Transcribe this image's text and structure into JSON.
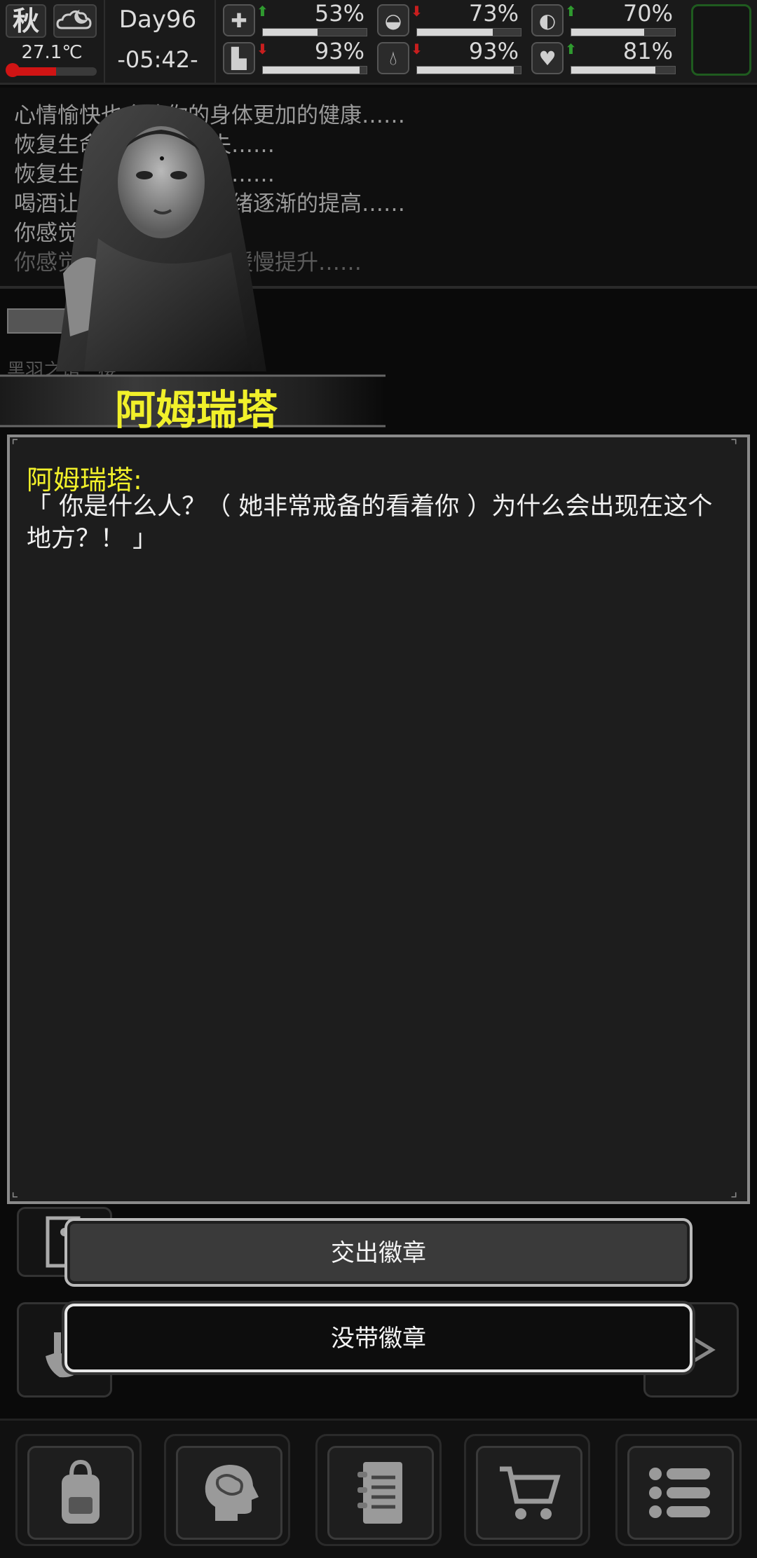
{
  "status": {
    "season": "秋",
    "temperature": "27.1℃",
    "temperature_level": 0.55,
    "day": "Day96",
    "time": "-05:42-",
    "colors": {
      "up_arrow": "#2f9a2f",
      "down_arrow": "#c81e1e",
      "temp_bar": "#d01414",
      "corner_border": "#1f5b1f"
    },
    "stats": [
      {
        "name": "health",
        "icon": "first-aid-icon",
        "trend": "up",
        "percent": "53%",
        "level": 0.53
      },
      {
        "name": "hunger",
        "icon": "stomach-icon",
        "trend": "down",
        "percent": "73%",
        "level": 0.73
      },
      {
        "name": "mood",
        "icon": "mood-icon",
        "trend": "up",
        "percent": "70%",
        "level": 0.7
      },
      {
        "name": "stamina",
        "icon": "boot-icon",
        "trend": "down",
        "percent": "93%",
        "level": 0.93
      },
      {
        "name": "thirst",
        "icon": "water-drop-icon",
        "trend": "down",
        "percent": "93%",
        "level": 0.93
      },
      {
        "name": "heart",
        "icon": "heart-icon",
        "trend": "up",
        "percent": "81%",
        "level": 0.81
      }
    ]
  },
  "log": {
    "lines": [
      "心情愉快也会让你的身体更加的健康……",
      "恢复生命效果已经消失……",
      "恢复生命效果已经消失……",
      "喝酒让你放松下来，情绪逐渐的提高……",
      "你感觉不再那么渴……",
      "你感觉到你的体力正在缓慢提升……"
    ]
  },
  "location": "黑羽之馆一楼",
  "npc": {
    "name": "阿姆瑞塔"
  },
  "dialog": {
    "speaker": "阿姆瑞塔:",
    "text": "「 你是什么人？（ 她非常戒备的看着你 ）为什么会出现在这个地方？！ 」"
  },
  "choices": [
    {
      "label": "交出徽章"
    },
    {
      "label": "没带徽章"
    }
  ],
  "nav": [
    "backpack-icon",
    "brain-icon",
    "journal-icon",
    "shop-cart-icon",
    "menu-icon"
  ]
}
